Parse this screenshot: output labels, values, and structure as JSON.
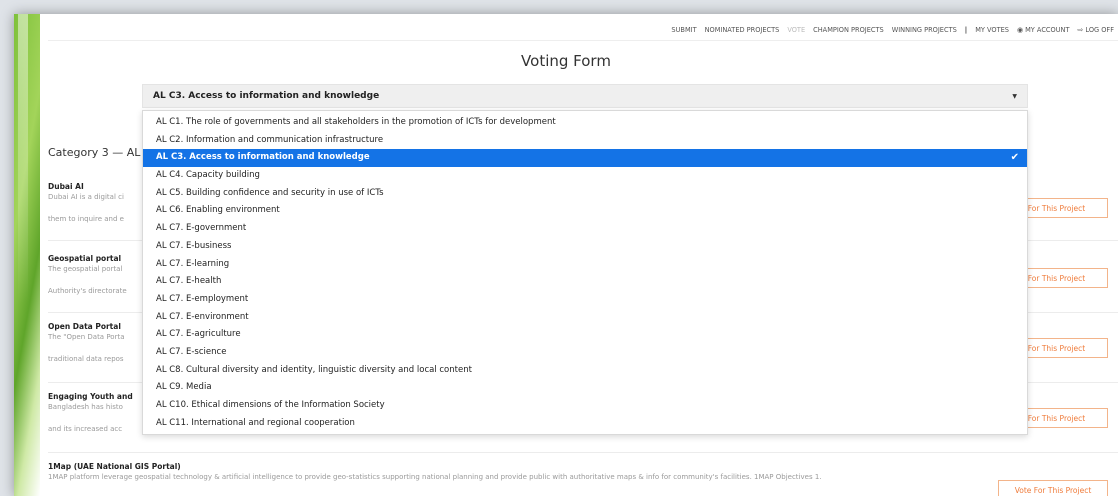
{
  "nav": {
    "items": [
      "SUBMIT",
      "NOMINATED PROJECTS",
      "VOTE",
      "CHAMPION PROJECTS",
      "WINNING PROJECTS"
    ],
    "separator": "|",
    "my_votes": "MY VOTES",
    "my_account": "MY ACCOUNT",
    "log_off": "LOG OFF",
    "account_icon": "user-circle-icon",
    "logoff_icon": "logout-icon",
    "active_color": "#bbbbbb"
  },
  "page": {
    "title": "Voting Form"
  },
  "select": {
    "value": "AL C3. Access to information and knowledge",
    "caret_icon": "caret-down-icon"
  },
  "category": {
    "heading": "Category 3 — AL"
  },
  "projects": [
    {
      "title": "Dubai AI",
      "desc": "Dubai AI is a digital ci",
      "desc2": "them to inquire and e"
    },
    {
      "title": "Geospatial portal",
      "desc": "The geospatial portal",
      "desc2": "Authority's directorate"
    },
    {
      "title": "Open Data Portal",
      "desc": "The \"Open Data Porta",
      "desc2": "traditional data repos"
    },
    {
      "title": "Engaging Youth and",
      "desc": "Bangladesh has histo",
      "desc2": "and its increased acc"
    },
    {
      "title": "1Map (UAE National GIS Portal)",
      "desc": "1MAP platform leverage geospatial technology & artificial intelligence to provide geo-statistics supporting national planning and provide public with authoritative maps & info for community's facilities. 1MAP Objectives 1.",
      "desc2": ""
    }
  ],
  "vote_buttons": [
    "e For This Project",
    "e For This Project",
    "e For This Project",
    "e For This Project",
    "Vote For This Project"
  ],
  "dropdown": {
    "selected_index": 2,
    "check_icon": "checkmark-icon",
    "options": [
      "AL C1. The role of governments and all stakeholders in the promotion of ICTs for development",
      "AL C2. Information and communication infrastructure",
      "AL C3. Access to information and knowledge",
      "AL C4. Capacity building",
      "AL C5. Building confidence and security in use of ICTs",
      "AL C6. Enabling environment",
      "AL C7. E-government",
      "AL C7. E-business",
      "AL C7. E-learning",
      "AL C7. E-health",
      "AL C7. E-employment",
      "AL C7. E-environment",
      "AL C7. E-agriculture",
      "AL C7. E-science",
      "AL C8. Cultural diversity and identity, linguistic diversity and local content",
      "AL C9. Media",
      "AL C10. Ethical dimensions of the Information Society",
      "AL C11. International and regional cooperation"
    ]
  },
  "colors": {
    "accent": "#ef7b3a",
    "selected": "#1473e6",
    "leaf": "#7ec13a"
  }
}
